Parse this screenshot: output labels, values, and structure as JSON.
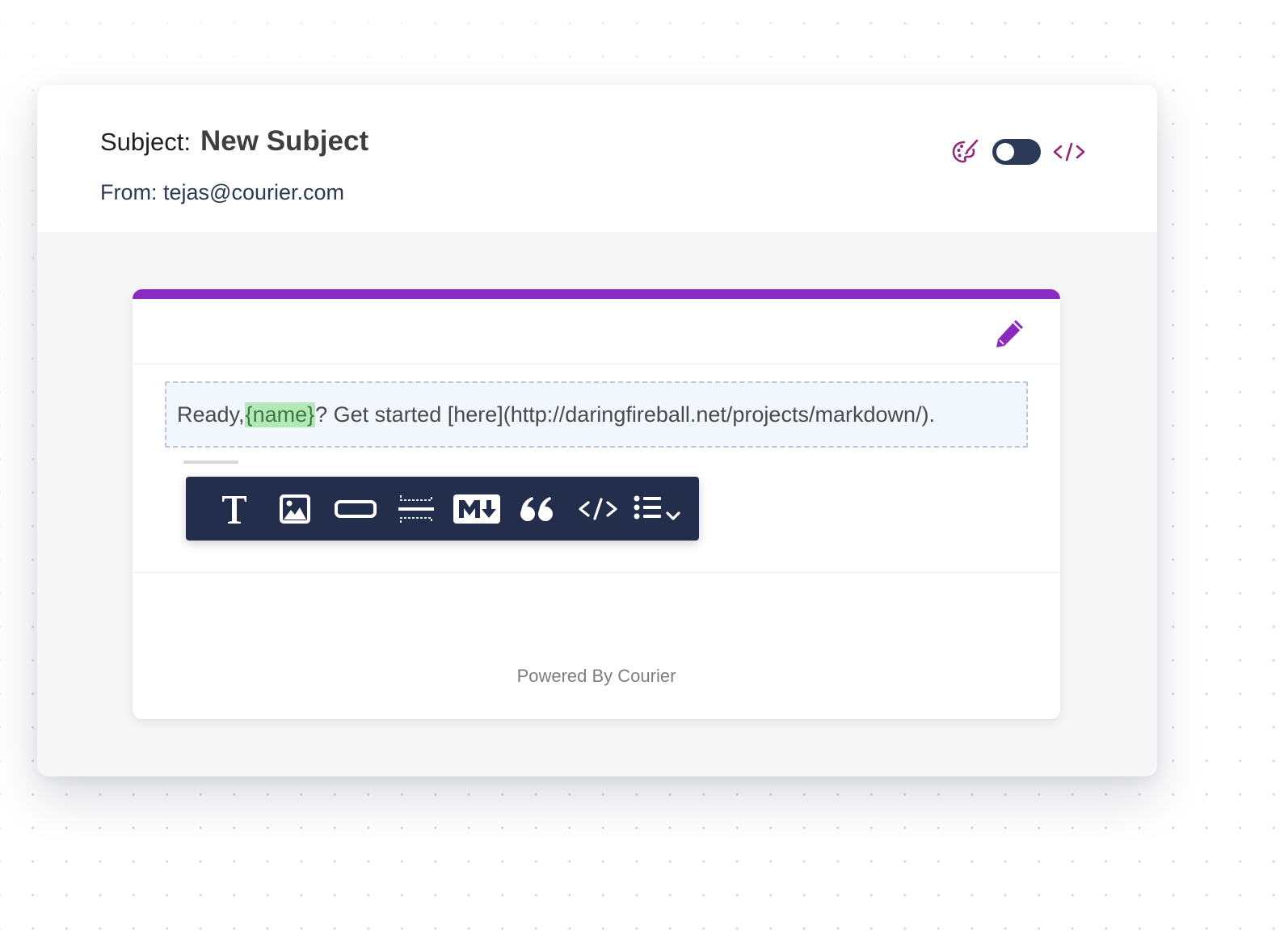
{
  "header": {
    "subject_label": "Subject:",
    "subject_value": "New Subject",
    "from_label": "From:",
    "from_value": "tejas@courier.com",
    "tools": {
      "theme_icon": "palette-icon",
      "toggle_state": "off",
      "code_icon": "code-icon"
    }
  },
  "card": {
    "accent_color": "#8a2ac0",
    "edit_icon": "pencil-icon",
    "body": {
      "text_before": "Ready, ",
      "variable": "{name}",
      "text_after": "? Get started [here](http://daringfireball.net/projects/markdown/)."
    },
    "toolbar": [
      {
        "name": "text-block-tool",
        "icon": "text-icon"
      },
      {
        "name": "image-block-tool",
        "icon": "image-icon"
      },
      {
        "name": "button-block-tool",
        "icon": "button-icon"
      },
      {
        "name": "divider-block-tool",
        "icon": "divider-icon"
      },
      {
        "name": "markdown-block-tool",
        "icon": "markdown-icon"
      },
      {
        "name": "quote-block-tool",
        "icon": "quote-icon"
      },
      {
        "name": "html-block-tool",
        "icon": "code-icon"
      },
      {
        "name": "list-block-tool",
        "icon": "list-icon"
      }
    ],
    "footer": "Powered By Courier"
  },
  "colors": {
    "toolbar_bg": "#222e4b",
    "toggle_bg": "#2c3a58",
    "brand_purple": "#8a2ac0",
    "icon_purple": "#8f2a7a"
  }
}
